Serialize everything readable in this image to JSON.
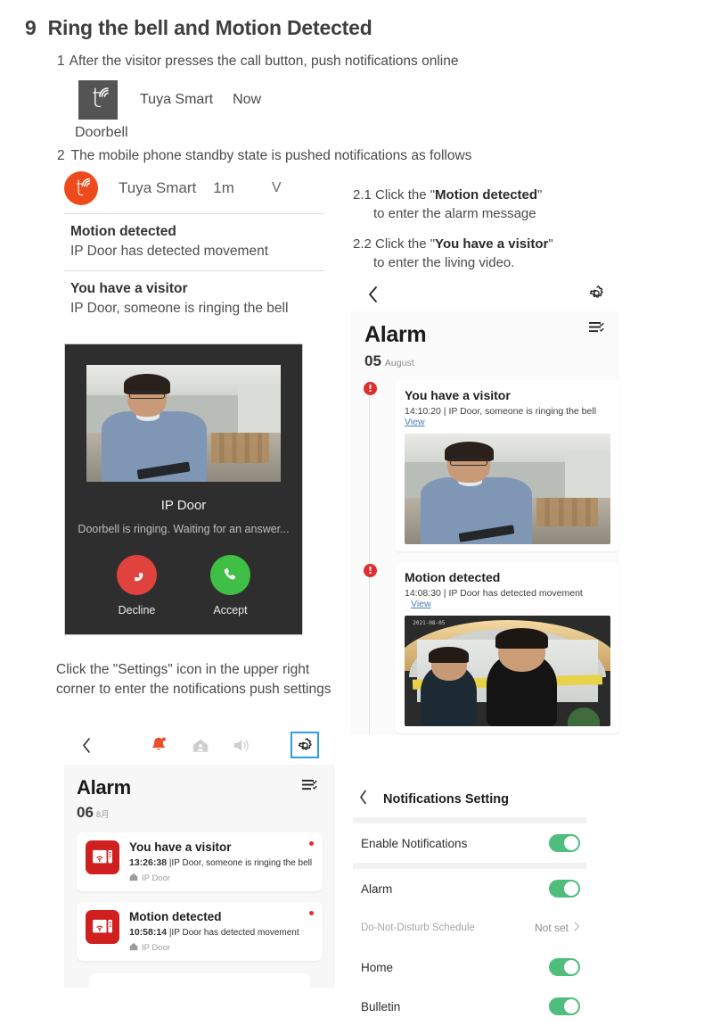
{
  "section": {
    "number": "9",
    "title": "Ring the bell and Motion Detected"
  },
  "step1": {
    "number": "1",
    "text": "After the visitor presses the call button, push notifications online"
  },
  "heads_up_notification": {
    "app_name": "Tuya Smart",
    "time": "Now",
    "body": "Doorbell",
    "icon": "tuya-logo-icon"
  },
  "step2": {
    "number": "2",
    "text": "The mobile phone standby state is pushed notifications  as follows"
  },
  "lockscreen": {
    "app_name": "Tuya Smart",
    "time": "1m",
    "chevron": "V",
    "items": [
      {
        "title": "Motion detected",
        "subtitle": "IP Door has detected movement"
      },
      {
        "title": "You have a visitor",
        "subtitle": "IP Door, someone is ringing the bell"
      }
    ]
  },
  "call_screen": {
    "device_name": "IP Door",
    "status": "Doorbell is ringing. Waiting for an answer...",
    "decline_label": "Decline",
    "accept_label": "Accept"
  },
  "instructions": {
    "r21": {
      "number": "2.1",
      "pre": "Click the \"",
      "bold": "Motion detected",
      "post": "\"",
      "line2": "to enter the alarm message"
    },
    "r22": {
      "number": "2.2",
      "pre": "Click the \"",
      "bold": "You have a visitor",
      "post": "\"",
      "line2": "to enter the living video."
    },
    "settings_note": "Click the \"Settings\" icon in the upper right corner to enter the notifications push settings"
  },
  "alarm_screen": {
    "title": "Alarm",
    "day": "05",
    "month": "August",
    "back_icon": "chevron-left-icon",
    "gear_icon": "gear-icon",
    "filter_icon": "filter-list-icon",
    "entries": [
      {
        "badge": "!",
        "title": "You have a visitor",
        "time": "14:10:20",
        "sep": "|",
        "detail": "IP Door, someone is ringing the bell",
        "view": "View",
        "view_inline": false
      },
      {
        "badge": "!",
        "title": "Motion detected",
        "time": "14:08:30",
        "sep": "|",
        "detail": "IP Door has detected movement",
        "view": "View",
        "view_inline": true
      }
    ]
  },
  "phone_alarm_screen": {
    "title": "Alarm",
    "day": "06",
    "month": "8月",
    "toolbar": {
      "back_icon": "chevron-left-icon",
      "bell_icon": "bell-alert-icon",
      "home_icon": "home-icon",
      "speaker_icon": "speaker-icon",
      "gear_icon": "gear-icon"
    },
    "filter_icon": "filter-list-icon",
    "items": [
      {
        "title": "You have a visitor",
        "time": "13:26:38",
        "sep": "|",
        "detail": "IP Door, someone is ringing the bell",
        "device": "IP Door",
        "icon": "doorbell-monitor-icon"
      },
      {
        "title": "Motion detected",
        "time": "10:58:14",
        "sep": "|",
        "detail": "IP Door has detected movement",
        "device": "IP Door",
        "icon": "doorbell-monitor-icon"
      }
    ]
  },
  "notifications_setting": {
    "title": "Notifications Setting",
    "back_icon": "chevron-left-icon",
    "rows": [
      {
        "label": "Enable Notifications",
        "type": "toggle",
        "value": "on"
      },
      {
        "label": "Alarm",
        "type": "toggle",
        "value": "on"
      },
      {
        "label": "Do-Not-Disturb Schedule",
        "type": "link",
        "value": "Not set"
      },
      {
        "label": "Home",
        "type": "toggle",
        "value": "on"
      },
      {
        "label": "Bulletin",
        "type": "toggle",
        "value": "on"
      }
    ]
  },
  "colors": {
    "tuya_orange": "#ee4a1c",
    "alert_red": "#e02d2d",
    "toggle_green": "#4ebd7d",
    "link_blue": "#4a7ebb",
    "highlight_blue": "#29a3e0",
    "decline_red": "#e0423e",
    "accept_green": "#3fbf46"
  },
  "photo_timestamp": "2021-08-05"
}
